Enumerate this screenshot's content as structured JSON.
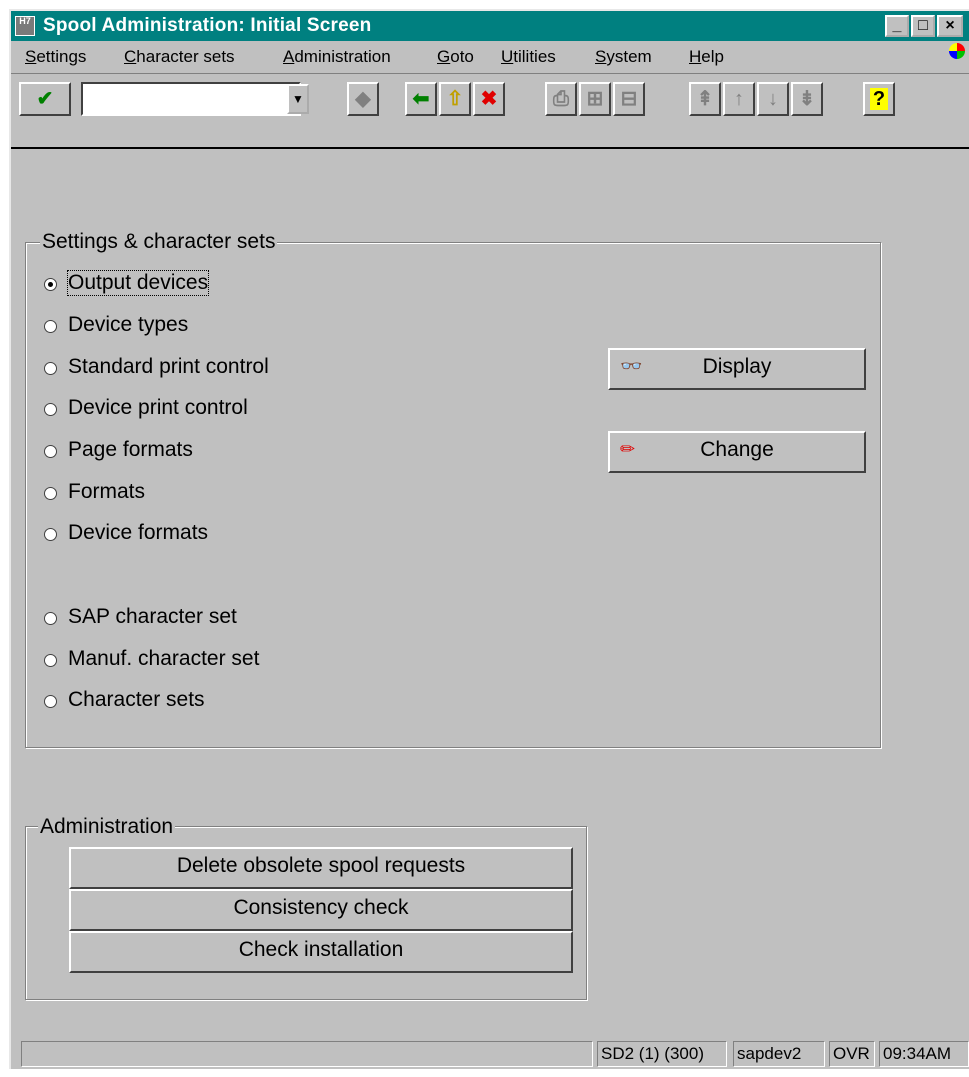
{
  "window": {
    "title": "Spool Administration: Initial Screen",
    "icon_text": "H7"
  },
  "menubar": {
    "items": [
      "Settings",
      "Character sets",
      "Administration",
      "Goto",
      "Utilities",
      "System",
      "Help"
    ]
  },
  "toolbar": {
    "command_value": ""
  },
  "settings_group": {
    "label": "Settings & character sets",
    "options": [
      "Output devices",
      "Device types",
      "Standard print control",
      "Device print control",
      "Page formats",
      "Formats",
      "Device formats",
      "SAP character set",
      "Manuf. character set",
      "Character sets"
    ],
    "selected": "Output devices",
    "display_label": "Display",
    "change_label": "Change"
  },
  "admin_group": {
    "label": "Administration",
    "buttons": [
      "Delete obsolete spool requests",
      "Consistency check",
      "Check installation"
    ]
  },
  "statusbar": {
    "message": "",
    "system": "SD2 (1) (300)",
    "server": "sapdev2",
    "mode": "OVR",
    "time": "09:34AM"
  },
  "colors": {
    "titlebar": "#008080",
    "background": "#c0c0c0",
    "confirm_green": "#008000",
    "cancel_red": "#e00000",
    "help_yellow": "#ffff00"
  }
}
